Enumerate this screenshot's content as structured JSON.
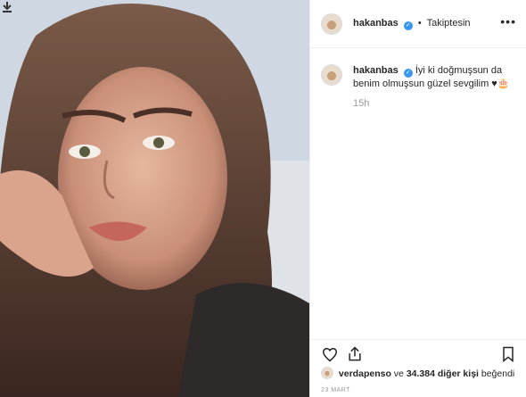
{
  "post": {
    "username": "hakanbas",
    "follow_status": "Takiptesin",
    "more": "•••",
    "caption_username": "hakanbas",
    "caption_text": "İyi ki doğmuşsun da benim olmuşsun güzel sevgilim ♥🎂",
    "time_ago": "15h",
    "likes_user": "verdapenso",
    "likes_mid": " ve ",
    "likes_count": "34.384 diğer kişi",
    "likes_suffix": " beğendi",
    "date": "23 MART"
  },
  "colors": {
    "verified": "#3897f0",
    "border": "#efefef",
    "muted": "#999999"
  },
  "icons": [
    "save-icon",
    "verified-icon",
    "more-icon",
    "heart-icon",
    "share-icon",
    "bookmark-icon"
  ]
}
